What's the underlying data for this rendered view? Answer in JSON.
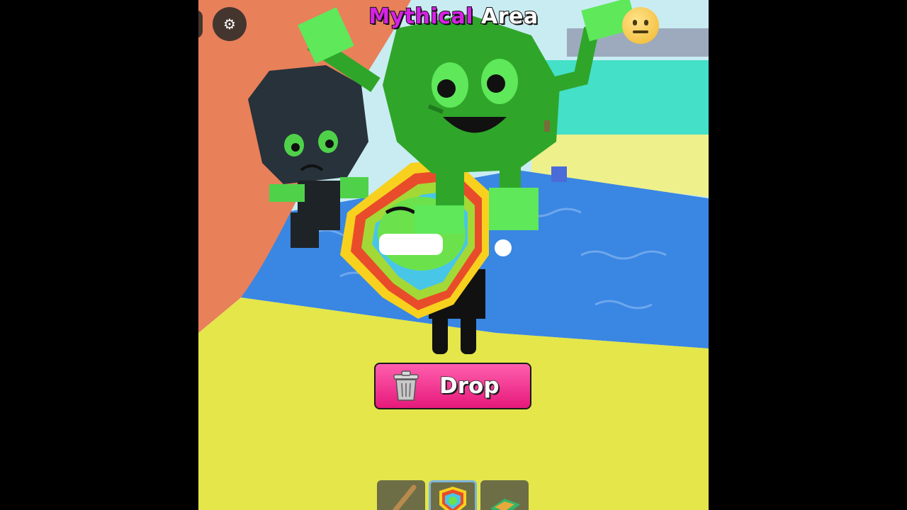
{
  "hud": {
    "area_title": {
      "name": "Mythical",
      "word": "Area"
    },
    "settings_icon": "gear-icon",
    "emote_icon": "neutral-face-emoji-icon",
    "drop_button": {
      "label": "Drop",
      "icon": "trash-can-icon"
    },
    "hotbar": {
      "selected_index": 1,
      "slots": [
        {
          "item": "bat-tool-icon"
        },
        {
          "item": "rainbow-shield-icon"
        },
        {
          "item": "rainbow-block-icon"
        }
      ]
    }
  },
  "colors": {
    "area_name": "#d622e6",
    "drop_button": "#f03a8e",
    "water": "#3a86e3",
    "ground": "#e8ea4a",
    "wall": "#e8805a",
    "green_creature": "#2fa62a",
    "dark_creature": "#27323a"
  }
}
